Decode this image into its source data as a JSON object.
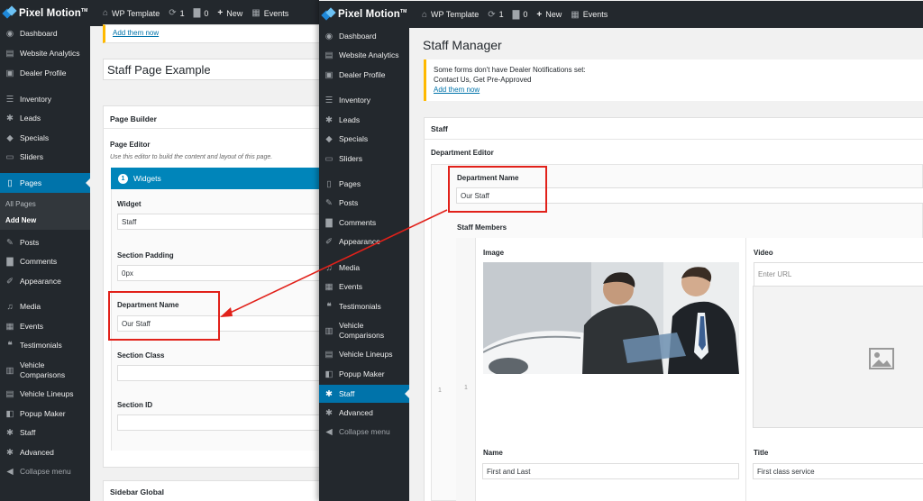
{
  "brand": {
    "name": "Pixel Motion",
    "mark": "TM"
  },
  "admin_bar": {
    "site": "WP Template",
    "updates": "1",
    "comments": "0",
    "new": "New",
    "events": "Events"
  },
  "sidebar_left": {
    "items": [
      {
        "label": "Dashboard",
        "icon": "dashboard-icon"
      },
      {
        "label": "Website Analytics",
        "icon": "chart-icon"
      },
      {
        "label": "Dealer Profile",
        "icon": "profile-icon"
      },
      {
        "label": "Inventory",
        "icon": "list-icon"
      },
      {
        "label": "Leads",
        "icon": "gear-icon"
      },
      {
        "label": "Specials",
        "icon": "tag-icon"
      },
      {
        "label": "Sliders",
        "icon": "slider-icon"
      },
      {
        "label": "Pages",
        "icon": "pages-icon"
      },
      {
        "label": "Posts",
        "icon": "pin-icon"
      },
      {
        "label": "Comments",
        "icon": "comment-icon"
      },
      {
        "label": "Appearance",
        "icon": "brush-icon"
      },
      {
        "label": "Media",
        "icon": "media-icon"
      },
      {
        "label": "Events",
        "icon": "calendar-icon"
      },
      {
        "label": "Testimonials",
        "icon": "quote-icon"
      },
      {
        "label": "Vehicle Comparisons",
        "icon": "compare-icon"
      },
      {
        "label": "Vehicle Lineups",
        "icon": "lineup-icon"
      },
      {
        "label": "Popup Maker",
        "icon": "popup-icon"
      },
      {
        "label": "Staff",
        "icon": "staff-icon"
      },
      {
        "label": "Advanced",
        "icon": "gear-icon"
      },
      {
        "label": "Collapse menu",
        "icon": "collapse-icon"
      }
    ],
    "submenu": [
      "All Pages",
      "Add New"
    ]
  },
  "sidebar_right": {
    "items": [
      {
        "label": "Dashboard",
        "icon": "dashboard-icon"
      },
      {
        "label": "Website Analytics",
        "icon": "chart-icon"
      },
      {
        "label": "Dealer Profile",
        "icon": "profile-icon"
      },
      {
        "label": "Inventory",
        "icon": "list-icon"
      },
      {
        "label": "Leads",
        "icon": "gear-icon"
      },
      {
        "label": "Specials",
        "icon": "tag-icon"
      },
      {
        "label": "Sliders",
        "icon": "slider-icon"
      },
      {
        "label": "Pages",
        "icon": "pages-icon"
      },
      {
        "label": "Posts",
        "icon": "pin-icon"
      },
      {
        "label": "Comments",
        "icon": "comment-icon"
      },
      {
        "label": "Appearance",
        "icon": "brush-icon"
      },
      {
        "label": "Media",
        "icon": "media-icon"
      },
      {
        "label": "Events",
        "icon": "calendar-icon"
      },
      {
        "label": "Testimonials",
        "icon": "quote-icon"
      },
      {
        "label": "Vehicle Comparisons",
        "icon": "compare-icon"
      },
      {
        "label": "Vehicle Lineups",
        "icon": "lineup-icon"
      },
      {
        "label": "Popup Maker",
        "icon": "popup-icon"
      },
      {
        "label": "Staff",
        "icon": "staff-icon"
      },
      {
        "label": "Advanced",
        "icon": "gear-icon"
      },
      {
        "label": "Collapse menu",
        "icon": "collapse-icon"
      }
    ]
  },
  "left_page": {
    "add_them_now": "Add them now",
    "title_value": "Staff Page Example",
    "page_builder_title": "Page Builder",
    "page_editor_label": "Page Editor",
    "page_editor_help": "Use this editor to build the content and layout of this page.",
    "widgets_num": "1",
    "widgets_label": "Widgets",
    "widget_label": "Widget",
    "widget_value": "Staff",
    "section_padding_label": "Section Padding",
    "section_padding_value": "0px",
    "department_name_label": "Department Name",
    "department_name_value": "Our Staff",
    "section_class_label": "Section Class",
    "section_id_label": "Section ID",
    "sidebar_global_title": "Sidebar Global"
  },
  "right_page": {
    "heading": "Staff Manager",
    "notice_line1": "Some forms don't have Dealer Notifications set:",
    "notice_line2": "Contact Us, Get Pre-Approved",
    "notice_link": "Add them now",
    "staff_box_title": "Staff",
    "department_editor_label": "Department Editor",
    "department_name_label": "Department Name",
    "department_name_value": "Our Staff",
    "staff_members_label": "Staff Members",
    "row_num": "1",
    "image_label": "Image",
    "video_label": "Video",
    "video_placeholder": "Enter URL",
    "name_label": "Name",
    "name_value": "First and Last",
    "title_label": "Title",
    "title_value": "First class service"
  },
  "colors": {
    "admin_dark": "#23282d",
    "accent_blue": "#0073aa",
    "highlight_red": "#e1211a",
    "notice_yellow": "#ffb900"
  }
}
